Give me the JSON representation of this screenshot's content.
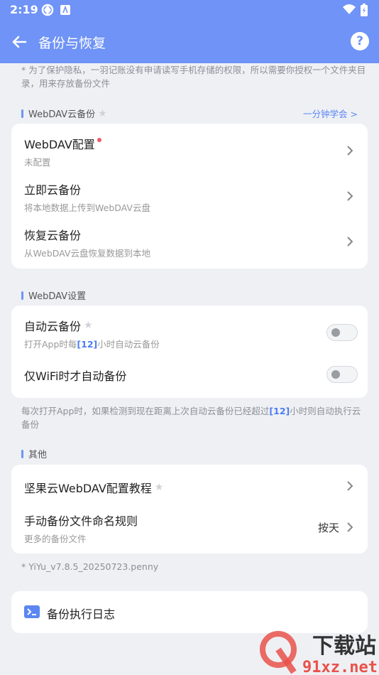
{
  "status_bar": {
    "time": "2:19"
  },
  "app_bar": {
    "title": "备份与恢复",
    "help": "?"
  },
  "privacy_note": "* 为了保护隐私，一羽记账没有申请读写手机存储的权限，所以需要你授权一个文件夹目录，用来存放备份文件",
  "webdav_cloud": {
    "header": "WebDAV云备份",
    "learn_link": "一分钟学会 >",
    "items": [
      {
        "title": "WebDAV配置",
        "subtitle": "未配置"
      },
      {
        "title": "立即云备份",
        "subtitle": "将本地数据上传到WebDAV云盘"
      },
      {
        "title": "恢复云备份",
        "subtitle": "从WebDAV云盘恢复数据到本地"
      }
    ]
  },
  "webdav_settings": {
    "header": "WebDAV设置",
    "auto_backup": {
      "title": "自动云备份",
      "sub_prefix": "打开App时每",
      "sub_hours": "[12]",
      "sub_suffix": "小时自动云备份",
      "enabled": false
    },
    "wifi_only": {
      "title": "仅WiFi时才自动备份",
      "enabled": false
    },
    "note_prefix": "每次打开App时，如果检测到现在距离上次自动云备份已经超过",
    "note_hours": "[12]",
    "note_suffix": "小时则自动执行云备份"
  },
  "other": {
    "header": "其他",
    "tutorial": {
      "title": "坚果云WebDAV配置教程"
    },
    "naming": {
      "title": "手动备份文件命名规则",
      "subtitle": "更多的备份文件",
      "value": "按天"
    }
  },
  "version": "* YiYu_v7.8.5_20250723.penny",
  "log": {
    "title": "备份执行日志"
  },
  "watermark": {
    "site": "91xz.net",
    "brand": "下载站"
  },
  "colors": {
    "accent": "#6f93f6",
    "link": "#5b86f3",
    "red_dot": "#f0596a"
  }
}
